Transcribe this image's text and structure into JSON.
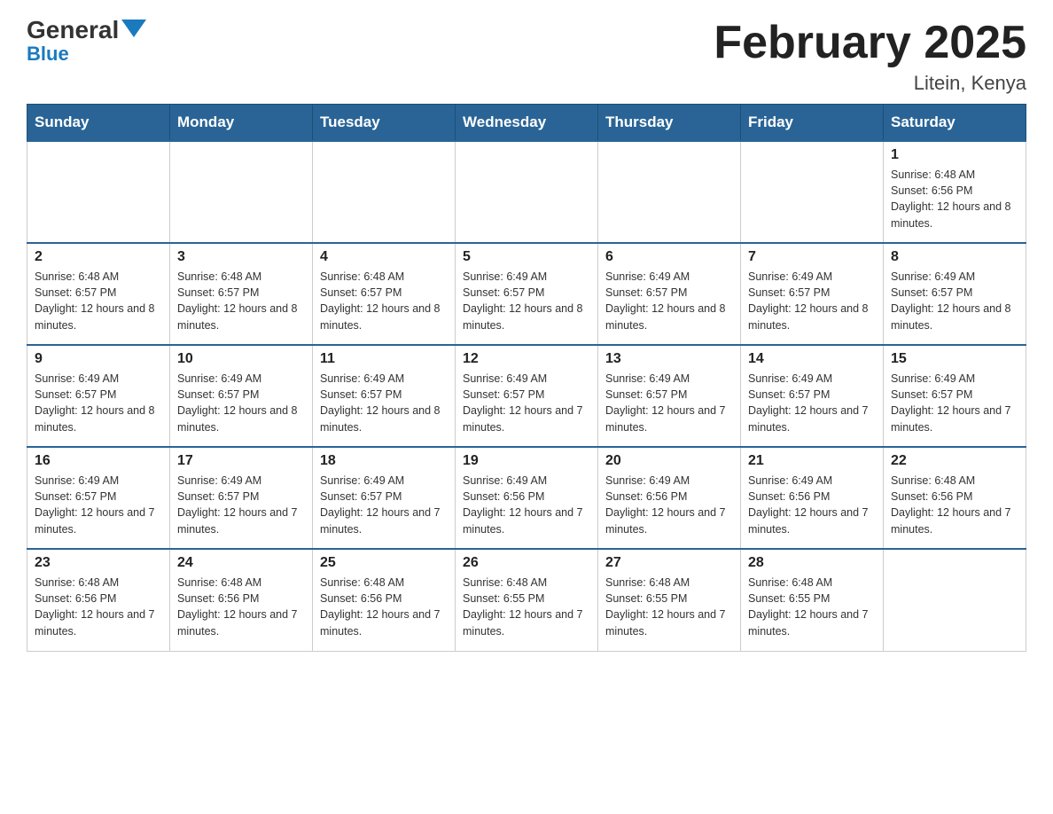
{
  "header": {
    "logo_general": "General",
    "logo_blue": "Blue",
    "month_title": "February 2025",
    "location": "Litein, Kenya"
  },
  "days_of_week": [
    "Sunday",
    "Monday",
    "Tuesday",
    "Wednesday",
    "Thursday",
    "Friday",
    "Saturday"
  ],
  "weeks": [
    [
      {
        "day": "",
        "info": "",
        "empty": true
      },
      {
        "day": "",
        "info": "",
        "empty": true
      },
      {
        "day": "",
        "info": "",
        "empty": true
      },
      {
        "day": "",
        "info": "",
        "empty": true
      },
      {
        "day": "",
        "info": "",
        "empty": true
      },
      {
        "day": "",
        "info": "",
        "empty": true
      },
      {
        "day": "1",
        "info": "Sunrise: 6:48 AM\nSunset: 6:56 PM\nDaylight: 12 hours and 8 minutes.",
        "empty": false
      }
    ],
    [
      {
        "day": "2",
        "info": "Sunrise: 6:48 AM\nSunset: 6:57 PM\nDaylight: 12 hours and 8 minutes.",
        "empty": false
      },
      {
        "day": "3",
        "info": "Sunrise: 6:48 AM\nSunset: 6:57 PM\nDaylight: 12 hours and 8 minutes.",
        "empty": false
      },
      {
        "day": "4",
        "info": "Sunrise: 6:48 AM\nSunset: 6:57 PM\nDaylight: 12 hours and 8 minutes.",
        "empty": false
      },
      {
        "day": "5",
        "info": "Sunrise: 6:49 AM\nSunset: 6:57 PM\nDaylight: 12 hours and 8 minutes.",
        "empty": false
      },
      {
        "day": "6",
        "info": "Sunrise: 6:49 AM\nSunset: 6:57 PM\nDaylight: 12 hours and 8 minutes.",
        "empty": false
      },
      {
        "day": "7",
        "info": "Sunrise: 6:49 AM\nSunset: 6:57 PM\nDaylight: 12 hours and 8 minutes.",
        "empty": false
      },
      {
        "day": "8",
        "info": "Sunrise: 6:49 AM\nSunset: 6:57 PM\nDaylight: 12 hours and 8 minutes.",
        "empty": false
      }
    ],
    [
      {
        "day": "9",
        "info": "Sunrise: 6:49 AM\nSunset: 6:57 PM\nDaylight: 12 hours and 8 minutes.",
        "empty": false
      },
      {
        "day": "10",
        "info": "Sunrise: 6:49 AM\nSunset: 6:57 PM\nDaylight: 12 hours and 8 minutes.",
        "empty": false
      },
      {
        "day": "11",
        "info": "Sunrise: 6:49 AM\nSunset: 6:57 PM\nDaylight: 12 hours and 8 minutes.",
        "empty": false
      },
      {
        "day": "12",
        "info": "Sunrise: 6:49 AM\nSunset: 6:57 PM\nDaylight: 12 hours and 7 minutes.",
        "empty": false
      },
      {
        "day": "13",
        "info": "Sunrise: 6:49 AM\nSunset: 6:57 PM\nDaylight: 12 hours and 7 minutes.",
        "empty": false
      },
      {
        "day": "14",
        "info": "Sunrise: 6:49 AM\nSunset: 6:57 PM\nDaylight: 12 hours and 7 minutes.",
        "empty": false
      },
      {
        "day": "15",
        "info": "Sunrise: 6:49 AM\nSunset: 6:57 PM\nDaylight: 12 hours and 7 minutes.",
        "empty": false
      }
    ],
    [
      {
        "day": "16",
        "info": "Sunrise: 6:49 AM\nSunset: 6:57 PM\nDaylight: 12 hours and 7 minutes.",
        "empty": false
      },
      {
        "day": "17",
        "info": "Sunrise: 6:49 AM\nSunset: 6:57 PM\nDaylight: 12 hours and 7 minutes.",
        "empty": false
      },
      {
        "day": "18",
        "info": "Sunrise: 6:49 AM\nSunset: 6:57 PM\nDaylight: 12 hours and 7 minutes.",
        "empty": false
      },
      {
        "day": "19",
        "info": "Sunrise: 6:49 AM\nSunset: 6:56 PM\nDaylight: 12 hours and 7 minutes.",
        "empty": false
      },
      {
        "day": "20",
        "info": "Sunrise: 6:49 AM\nSunset: 6:56 PM\nDaylight: 12 hours and 7 minutes.",
        "empty": false
      },
      {
        "day": "21",
        "info": "Sunrise: 6:49 AM\nSunset: 6:56 PM\nDaylight: 12 hours and 7 minutes.",
        "empty": false
      },
      {
        "day": "22",
        "info": "Sunrise: 6:48 AM\nSunset: 6:56 PM\nDaylight: 12 hours and 7 minutes.",
        "empty": false
      }
    ],
    [
      {
        "day": "23",
        "info": "Sunrise: 6:48 AM\nSunset: 6:56 PM\nDaylight: 12 hours and 7 minutes.",
        "empty": false
      },
      {
        "day": "24",
        "info": "Sunrise: 6:48 AM\nSunset: 6:56 PM\nDaylight: 12 hours and 7 minutes.",
        "empty": false
      },
      {
        "day": "25",
        "info": "Sunrise: 6:48 AM\nSunset: 6:56 PM\nDaylight: 12 hours and 7 minutes.",
        "empty": false
      },
      {
        "day": "26",
        "info": "Sunrise: 6:48 AM\nSunset: 6:55 PM\nDaylight: 12 hours and 7 minutes.",
        "empty": false
      },
      {
        "day": "27",
        "info": "Sunrise: 6:48 AM\nSunset: 6:55 PM\nDaylight: 12 hours and 7 minutes.",
        "empty": false
      },
      {
        "day": "28",
        "info": "Sunrise: 6:48 AM\nSunset: 6:55 PM\nDaylight: 12 hours and 7 minutes.",
        "empty": false
      },
      {
        "day": "",
        "info": "",
        "empty": true
      }
    ]
  ]
}
